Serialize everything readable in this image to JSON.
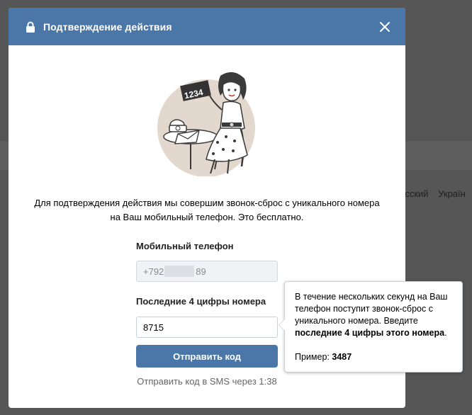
{
  "background": {
    "languages": [
      "усский",
      "Україн"
    ]
  },
  "modal": {
    "title": "Подтверждение действия",
    "description_line1": "Для подтверждения действия мы совершим звонок-сброс с уникального номера",
    "description_line2": "на Ваш мобильный телефон. Это бесплатно.",
    "phone_label": "Мобильный телефон",
    "phone_prefix": "+792",
    "phone_suffix": "89",
    "code_label": "Последние 4 цифры номера",
    "code_value": "8715",
    "submit_label": "Отправить код",
    "sms_timer": "Отправить код в SMS через 1:38",
    "illustration_card_text": "1234"
  },
  "tooltip": {
    "text_before": "В течение нескольких секунд на Ваш телефон поступит звонок-сброс с уникального номера. Введите",
    "text_bold": "последние 4 цифры этого номера",
    "text_after": ".",
    "example_label": "Пример:",
    "example_value": "3487"
  },
  "colors": {
    "header": "#4a76a8",
    "button": "#4a76a8",
    "overlay": "#565656"
  },
  "icons": {
    "lock": "lock-icon",
    "close": "close-icon"
  }
}
